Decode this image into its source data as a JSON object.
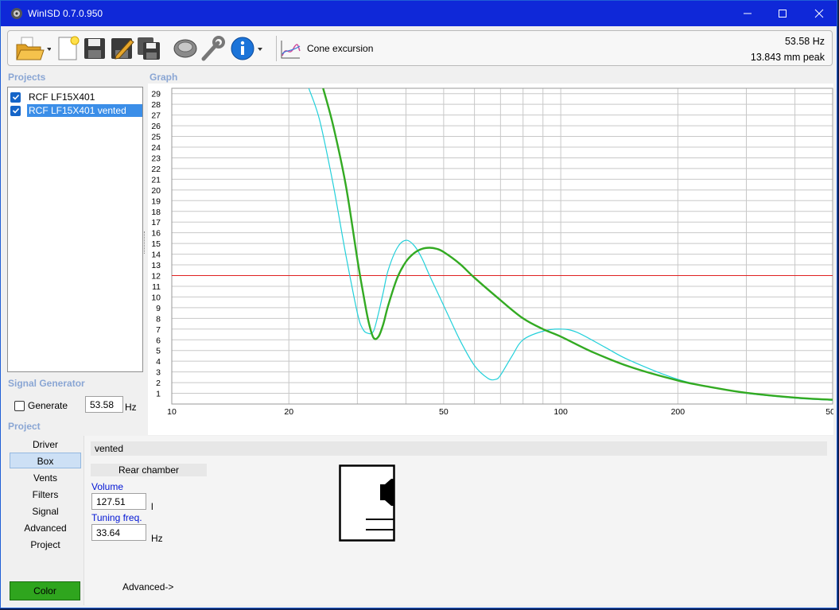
{
  "window": {
    "title": "WinISD 0.7.0.950"
  },
  "toolbar": {
    "mode_label": "Cone excursion",
    "readout_freq": "53.58 Hz",
    "readout_value": "13.843 mm peak",
    "icons": [
      "open-folder-icon",
      "new-document-icon",
      "save-icon",
      "save-as-icon",
      "save-all-icon",
      "driver-icon",
      "tools-icon",
      "info-icon",
      "cone-excursion-icon"
    ]
  },
  "sections": {
    "projects": "Projects",
    "graph": "Graph",
    "signal_generator": "Signal Generator",
    "project": "Project"
  },
  "projects": [
    {
      "name": "RCF  LF15X401",
      "checked": true,
      "selected": false
    },
    {
      "name": "RCF  LF15X401 vented",
      "checked": true,
      "selected": true
    }
  ],
  "signal_generator": {
    "generate_label": "Generate",
    "generate_checked": false,
    "frequency": "53.58",
    "unit": "Hz"
  },
  "project_nav": {
    "items": [
      "Driver",
      "Box",
      "Vents",
      "Filters",
      "Signal",
      "Advanced",
      "Project"
    ],
    "active": "Box",
    "color_label": "Color"
  },
  "box_panel": {
    "title": "vented",
    "rear_chamber_label": "Rear chamber",
    "volume_label": "Volume",
    "volume_value": "127.51",
    "volume_unit": "l",
    "tuning_label": "Tuning freq.",
    "tuning_value": "33.64",
    "tuning_unit": "Hz",
    "advanced_label": "Advanced->"
  },
  "colors": {
    "titlebar": "#0f28d8",
    "series_sealed": "#22d0da",
    "series_vented": "#33aa22",
    "limit_line": "#e02020",
    "color_button": "#2fa51e"
  },
  "chart_data": {
    "type": "line",
    "x_scale": "log",
    "xlim": [
      10,
      500
    ],
    "ylim": [
      0,
      29.5
    ],
    "x_ticks": [
      10,
      20,
      50,
      100,
      200,
      500
    ],
    "y_ticks": [
      1,
      2,
      3,
      4,
      5,
      6,
      7,
      8,
      9,
      10,
      11,
      12,
      13,
      14,
      15,
      16,
      17,
      18,
      19,
      20,
      21,
      22,
      23,
      24,
      25,
      26,
      27,
      28,
      29
    ],
    "grid": true,
    "limit_line": 12,
    "series": [
      {
        "x": [
          22.5,
          24,
          26,
          28,
          30,
          31,
          32,
          33,
          34,
          35,
          36,
          38,
          40,
          42,
          44,
          46,
          50,
          55,
          60,
          65,
          68,
          70,
          75,
          80,
          90,
          100,
          110,
          130,
          150,
          200,
          250,
          300,
          400,
          500
        ],
        "y": [
          29.5,
          26.5,
          20.5,
          14,
          8.5,
          7.0,
          6.6,
          6.8,
          8.5,
          10.5,
          12.5,
          14.6,
          15.3,
          14.8,
          13.6,
          12.0,
          9.2,
          6.0,
          3.6,
          2.4,
          2.3,
          2.7,
          4.5,
          6.0,
          6.8,
          7.0,
          6.7,
          5.3,
          4.1,
          2.3,
          1.5,
          1.0,
          0.55,
          0.35
        ]
      },
      {
        "x": [
          24.5,
          26,
          28,
          30,
          31,
          32,
          33,
          34,
          35,
          36,
          38,
          40,
          42,
          44,
          46,
          48,
          50,
          55,
          60,
          70,
          80,
          90,
          100,
          120,
          150,
          200,
          250,
          300,
          400,
          500
        ],
        "y": [
          29.5,
          26,
          20.5,
          13.5,
          10.5,
          7.8,
          6.2,
          6.3,
          7.5,
          9.2,
          11.8,
          13.3,
          14.1,
          14.5,
          14.6,
          14.5,
          14.2,
          13.1,
          11.8,
          9.7,
          8.0,
          7.0,
          6.3,
          4.9,
          3.5,
          2.2,
          1.5,
          1.05,
          0.6,
          0.4
        ]
      }
    ]
  }
}
